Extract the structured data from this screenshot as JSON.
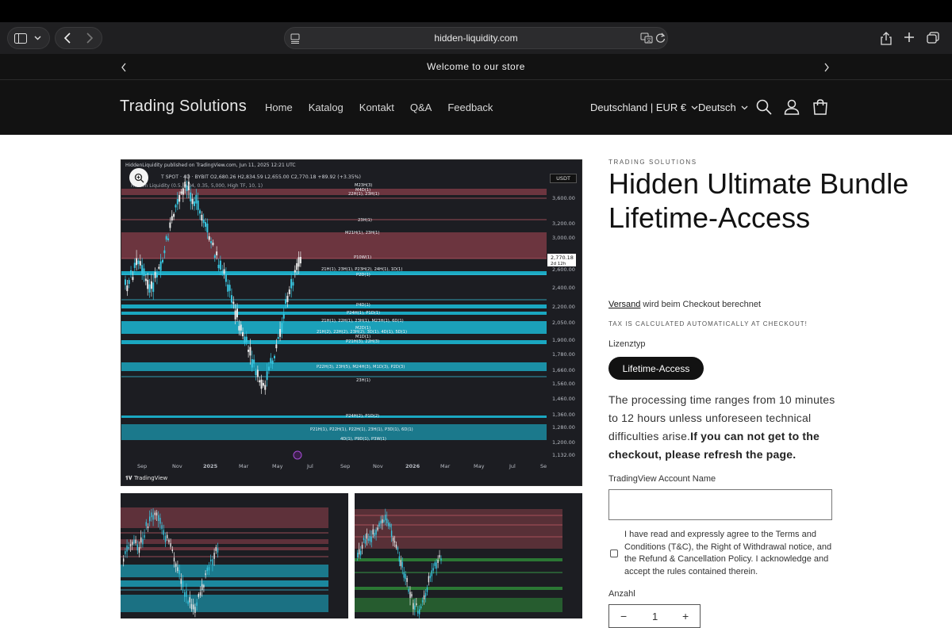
{
  "browser": {
    "url": "hidden-liquidity.com"
  },
  "announcement": {
    "text": "Welcome to our store"
  },
  "header": {
    "logo": "Trading Solutions",
    "nav": [
      "Home",
      "Katalog",
      "Kontakt",
      "Q&A",
      "Feedback"
    ],
    "country": "Deutschland | EUR €",
    "language": "Deutsch"
  },
  "chart": {
    "publisher": "HiddenLiquidity published on TradingView.com, Jun 11, 2025 12:21 UTC",
    "symbol_line": "T SPOT · 4D · BYBIT  O2,680.26  H2,834.59  L2,655.00  C2,770.18  +89.92 (+3.35%)",
    "indicator_line": "Hidden Liquidity (0.5, 0.04, 0.35, 5,000, High TF, 10, 1)",
    "currency": "USDT",
    "price_label": "2,770.18",
    "price_sub": "2d 12h",
    "tv_brand": "TradingView",
    "y_ticks": [
      "3,600.00",
      "3,200.00",
      "3,000.00",
      "2,600.00",
      "2,400.00",
      "2,200.00",
      "2,050.00",
      "1,900.00",
      "1,780.00",
      "1,660.00",
      "1,560.00",
      "1,460.00",
      "1,360.00",
      "1,280.00",
      "1,200.00",
      "1,132.00"
    ],
    "x_ticks": [
      "Sep",
      "Nov",
      "2025",
      "Mar",
      "May",
      "Jul",
      "Sep",
      "Nov",
      "2026",
      "Mar",
      "May",
      "Jul",
      "Se"
    ],
    "zone_labels": [
      "M23H(3)",
      "M4D(1)",
      "22H(1), 23H(1)",
      "23H(1)",
      "M21H(1), 23H(1)",
      "P10W(1)",
      "21H(1), 23H(1), P23H(2), 24H(1), 1D(1)",
      "P2D(1)",
      "P4D(1)",
      "P24H(1), P1D(1)",
      "21H(1), 22H(1), 23H(1), M23H(1), 6D(1)",
      "M2D(1)",
      "21H(2), 22H(2), 23H(2), 3D(1), 4D(1), 5D(1)",
      "M1D(1)",
      "P21H(3), 22H(3)",
      "P22H(3), 23H(5), M24H(3), M1D(3), P2D(3)",
      "23H(1)",
      "P24H(2), P1D(2)",
      "P21H(1), P22H(1), P22H(1), 23H(1), P3D(1), 6D(1)",
      "4D(1), P9D(1), P3W(1)"
    ]
  },
  "product": {
    "vendor": "TRADING SOLUTIONS",
    "title": "Hidden Ultimate Bundle Lifetime-Access",
    "shipping_link": "Versand",
    "shipping_rest": " wird beim Checkout berechnet",
    "tax_note": "TAX IS CALCULATED AUTOMATICALLY AT CHECKOUT!",
    "license_label": "Lizenztyp",
    "license_option": "Lifetime-Access",
    "description": "The processing time ranges from 10 minutes to 12 hours unless unforeseen technical difficulties arise.",
    "description_bold": "If you can not get to the checkout, please refresh the page.",
    "account_label": "TradingView Account Name",
    "agree_text": "I have read and expressly agree to the Terms and Conditions (T&C), the Right of Withdrawal notice, and the Refund & Cancellation Policy. I acknowledge and accept the rules contained therein.",
    "quantity_label": "Anzahl",
    "quantity_value": "1",
    "qty_minus": "−",
    "qty_plus": "+"
  },
  "colors": {
    "brand_dark": "#121212",
    "zone_red": "#7a3a44",
    "zone_cyan": "#1bb7d3",
    "candle_cyan": "#38c6e0",
    "candle_white": "#eaeaea"
  }
}
